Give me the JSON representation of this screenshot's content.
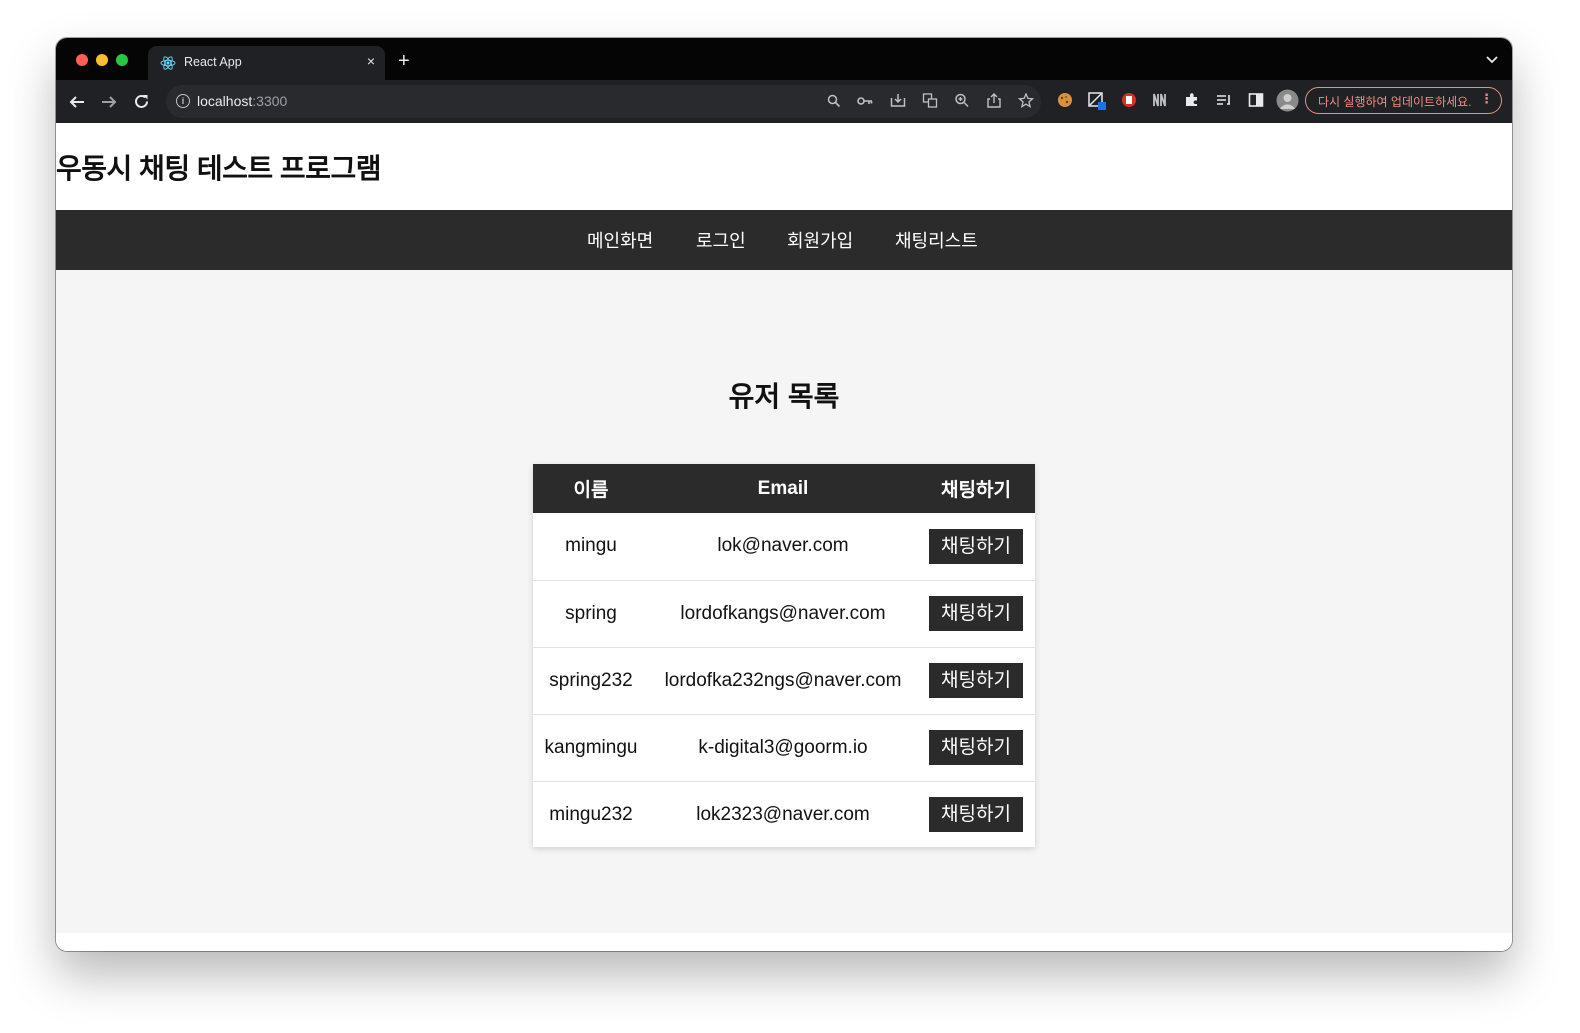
{
  "browser": {
    "tab_title": "React App",
    "tab_close": "×",
    "new_tab": "+",
    "tab_menu": "⌄",
    "url_host": "localhost",
    "url_port": ":3300",
    "update_text": "다시 실행하여 업데이트하세요.",
    "update_menu": "⋮",
    "icons": [
      "back-arrow-icon",
      "forward-arrow-icon",
      "reload-icon",
      "site-info-icon",
      "search-icon",
      "key-icon",
      "install-icon",
      "translate-icon",
      "zoom-icon",
      "share-icon",
      "star-icon",
      "cookie-icon",
      "extension-icon",
      "puzzle-icon",
      "reading-list-icon",
      "side-panel-icon",
      "profile-avatar-icon"
    ]
  },
  "site": {
    "title": "우동시 채팅 테스트 프로그램",
    "nav": [
      "메인화면",
      "로그인",
      "회원가입",
      "채팅리스트"
    ]
  },
  "main": {
    "heading": "유저 목록",
    "columns": [
      "이름",
      "Email",
      "채팅하기"
    ],
    "rows": [
      {
        "name": "mingu",
        "email": "lok@naver.com",
        "action": "채팅하기"
      },
      {
        "name": "spring",
        "email": "lordofkangs@naver.com",
        "action": "채팅하기"
      },
      {
        "name": "spring232",
        "email": "lordofka232ngs@naver.com",
        "action": "채팅하기"
      },
      {
        "name": "kangmingu",
        "email": "k-digital3@goorm.io",
        "action": "채팅하기"
      },
      {
        "name": "mingu232",
        "email": "lok2323@naver.com",
        "action": "채팅하기"
      }
    ]
  },
  "colors": {
    "nav_bg": "#2b2b2b",
    "page_bg": "#f5f5f5",
    "button_bg": "#2b2b2b",
    "update_accent": "#f28b82"
  }
}
